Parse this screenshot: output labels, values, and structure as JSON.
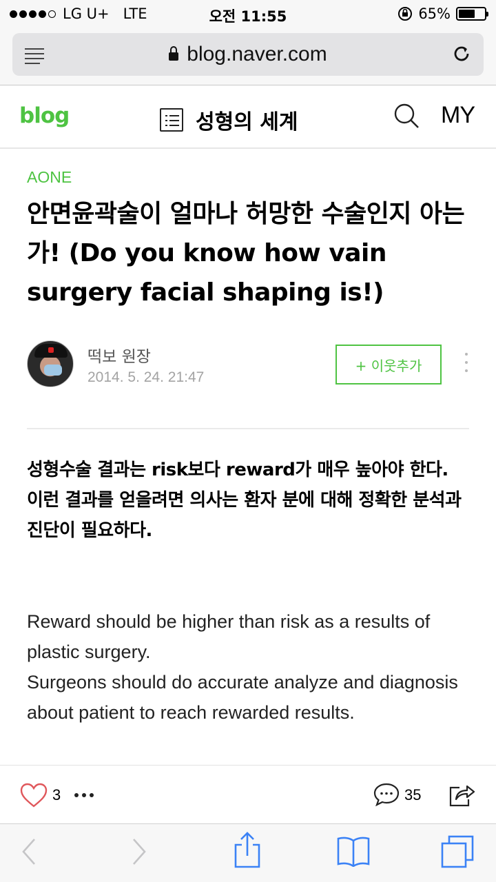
{
  "status_bar": {
    "carrier": "LG U+",
    "network": "LTE",
    "time": "오전 11:55",
    "battery_percent": "65%",
    "battery_level": 0.65
  },
  "browser": {
    "url": "blog.naver.com",
    "icons": [
      "reader-menu-icon",
      "lock-icon",
      "reload-icon"
    ]
  },
  "blog_header": {
    "logo": "blog",
    "blog_title": "성형의 세계",
    "my_label": "MY",
    "brand_color": "#4ec342"
  },
  "post": {
    "category": "AONE",
    "title": "안면윤곽술이 얼마나 허망한 수술인지 아는가! (Do you know how vain surgery facial shaping is!)",
    "author": "떡보 원장",
    "date": "2014. 5. 24. 21:47",
    "add_neighbor_label": "+ 이웃추가",
    "body_korean": [
      "성형수술 결과는  risk보다 reward가 매우 높아야 한다.",
      "이런 결과를 얻을려면 의사는 환자 분에 대해 정확한 분석과 진단이 필요하다."
    ],
    "body_english": [
      "Reward should be higher than risk as a results of plastic surgery.",
      "Surgeons should do accurate analyze and diagnosis about patient to reach rewarded results."
    ]
  },
  "actions": {
    "like_count": "3",
    "comment_count": "35",
    "heart_color": "#e0575b"
  },
  "toolbar": {
    "icons": [
      "back-icon",
      "forward-icon",
      "share-icon",
      "bookmarks-icon",
      "tabs-icon"
    ],
    "accent": "#3b82f6"
  }
}
